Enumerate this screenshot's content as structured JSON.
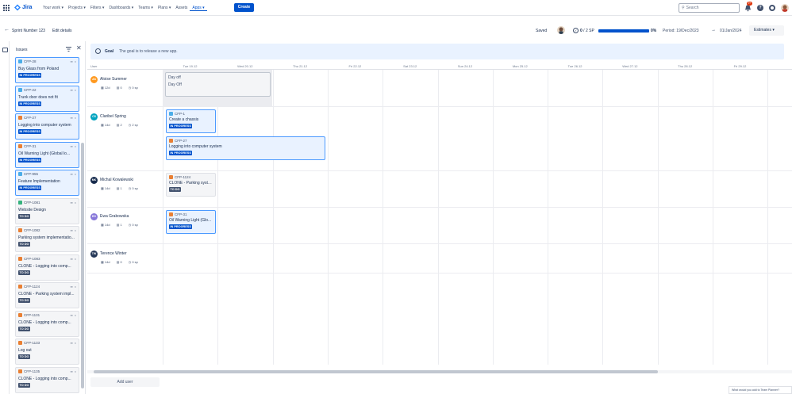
{
  "nav": {
    "logo_text": "Jira",
    "items": [
      "Your work ▾",
      "Projects ▾",
      "Filters ▾",
      "Dashboards ▾",
      "Teams ▾",
      "Plans ▾",
      "Assets",
      "Apps ▾"
    ],
    "create_label": "Create",
    "search_placeholder": "Search",
    "notif_count": "9+",
    "help_label": "?"
  },
  "sprint": {
    "back": "←",
    "title": "Sprint Number 123",
    "edit": "Edit details",
    "saved": "Saved",
    "sp_done": "0",
    "sp_total": " / 2 SP",
    "progress_pct": 0,
    "progress_label": "0%",
    "period_label": "Period:",
    "start": "19/Dec/2023",
    "arrow": "→",
    "end": "01/Jan/2024",
    "estimates_label": "Estimates ▾"
  },
  "issues_panel": {
    "title": "Issues",
    "cards": [
      {
        "key": "CFP-28",
        "type": "task",
        "title": "Buy Glass from Poland",
        "status": "IN PROGRESS",
        "state": "prog"
      },
      {
        "key": "CFP-22",
        "type": "task",
        "title": "Trunk door does not fit",
        "status": "IN PROGRESS",
        "state": "prog"
      },
      {
        "key": "CFP-27",
        "type": "bug",
        "title": "Logging into computer system",
        "status": "IN PROGRESS",
        "state": "prog"
      },
      {
        "key": "CFP-31",
        "type": "bug",
        "title": "Oil Warning Light (Global lo...",
        "status": "IN PROGRESS",
        "state": "prog"
      },
      {
        "key": "CFP-955",
        "type": "task",
        "title": "Feature Implementation",
        "status": "IN PROGRESS",
        "state": "prog"
      },
      {
        "key": "CFP-1081",
        "type": "story",
        "title": "Website Design",
        "status": "TO DO",
        "state": "todo"
      },
      {
        "key": "CFP-1082",
        "type": "bug",
        "title": "Parking system implementatio...",
        "status": "TO DO",
        "state": "todo"
      },
      {
        "key": "CFP-1083",
        "type": "bug",
        "title": "CLONE - Logging into comp...",
        "status": "TO DO",
        "state": "todo"
      },
      {
        "key": "CFP-1124",
        "type": "bug",
        "title": "CLONE - Parking system impl...",
        "status": "TO DO",
        "state": "todo"
      },
      {
        "key": "CFP-1131",
        "type": "bug",
        "title": "CLONE - Logging into comp...",
        "status": "TO DO",
        "state": "todo"
      },
      {
        "key": "CFP-1133",
        "type": "bug",
        "title": "Log out",
        "status": "TO DO",
        "state": "todo"
      },
      {
        "key": "CFP-1135",
        "type": "bug",
        "title": "CLONE - Logging into comp...",
        "status": "TO DO",
        "state": "todo"
      }
    ]
  },
  "goal": {
    "label": "Goal",
    "text": "The goal is to release a new app."
  },
  "grid": {
    "user_header": "User",
    "days": [
      "Tue 19.12",
      "Wed 20.12",
      "Thu 21.12",
      "Fri 22.12",
      "Sat 23.12",
      "Sun 24.12",
      "Mon 25.12",
      "Tue 26.12",
      "Wed 27.12",
      "Thu 28.12",
      "Fri 29.12"
    ]
  },
  "users": [
    {
      "name": "Aloise Summer",
      "initials": "AS",
      "color": "#ff991f",
      "hours": "12d",
      "issues": "0",
      "sp": "0 sp"
    },
    {
      "name": "Claribel Spring",
      "initials": "CS",
      "color": "#00a3bf",
      "hours": "14d",
      "issues": "2",
      "sp": "2 sp"
    },
    {
      "name": "Michal Kowalewski",
      "initials": "MK",
      "color": "#172b4d",
      "hours": "14d",
      "issues": "1",
      "sp": "0 sp"
    },
    {
      "name": "Ewa Grabowska",
      "initials": "EG",
      "color": "#8777d9",
      "hours": "14d",
      "issues": "1",
      "sp": "0 sp"
    },
    {
      "name": "Terence Winter",
      "initials": "TW",
      "color": "#253858",
      "hours": "14d",
      "issues": "0",
      "sp": "0 sp"
    }
  ],
  "dayoff": {
    "title": "Day off",
    "sub": "Day Off"
  },
  "grid_cards": [
    {
      "key": "CFP-1",
      "title": "Create a chassis",
      "status": "IN PROGRESS",
      "type": "task"
    },
    {
      "key": "CFP-27",
      "title": "Logging into computer system",
      "status": "IN PROGRESS",
      "type": "bug"
    },
    {
      "key": "CFP-1124",
      "title": "CLONE - Parking syste...",
      "status": "TO DO",
      "type": "bug"
    },
    {
      "key": "CFP-31",
      "title": "Oil Warning Light (Glo...",
      "status": "IN PROGRESS",
      "type": "bug"
    }
  ],
  "add_user": "Add user",
  "feedback": "What would you add to Team Planner?"
}
